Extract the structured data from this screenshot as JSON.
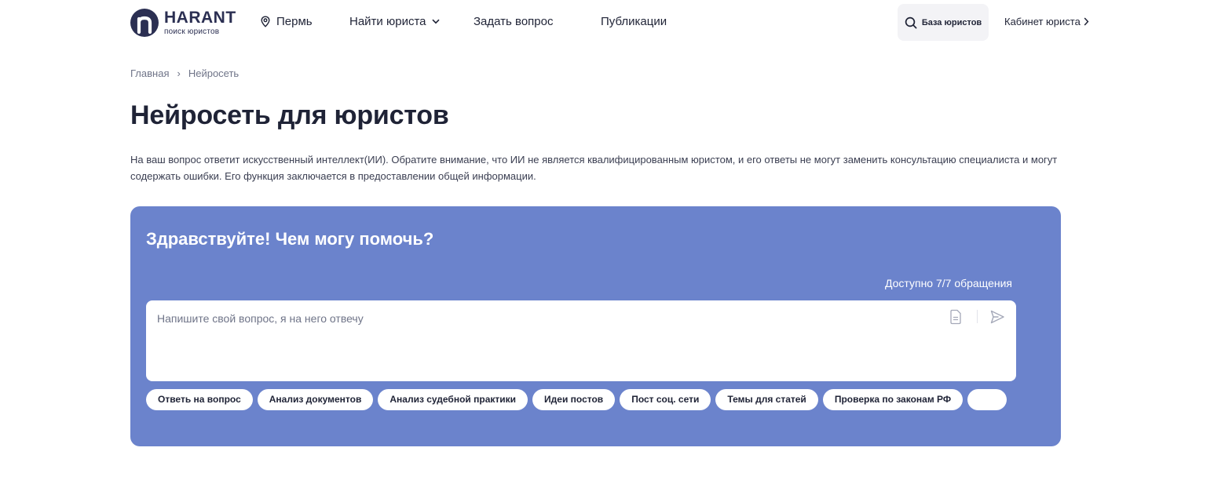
{
  "header": {
    "logo": {
      "name": "HARANT",
      "subtitle": "поиск юристов"
    },
    "city": "Пермь",
    "nav": {
      "find_lawyer": "Найти юриста",
      "ask_question": "Задать вопрос",
      "publications": "Публикации"
    },
    "base_button": "База юристов",
    "cabinet": "Кабинет юриста"
  },
  "breadcrumb": {
    "home": "Главная",
    "separator": "›",
    "current": "Нейросеть"
  },
  "page": {
    "title": "Нейросеть для юристов",
    "description": "На ваш вопрос ответит искусственный интеллект(ИИ). Обратите внимание, что ИИ не является квалифицированным юристом, и его ответы не могут заменить консультацию специалиста и могут содержать ошибки. Его функция заключается в предоставлении общей информации."
  },
  "chat": {
    "greeting": "Здравствуйте! Чем могу помочь?",
    "quota": "Доступно 7/7 обращения",
    "input_placeholder": "Напишите свой вопрос, я на него отвечу",
    "chips": [
      "Ответь на вопрос",
      "Анализ документов",
      "Анализ судебной практики",
      "Идеи постов",
      "Пост соц. сети",
      "Темы для статей",
      "Проверка по законам РФ",
      ""
    ]
  },
  "colors": {
    "brand_dark": "#2b2f52",
    "card_bg": "#6b83cc",
    "text_primary": "#1f2336",
    "text_muted": "#6f7488"
  },
  "icons": {
    "logo": "harant-logo-icon",
    "city": "location-pin-icon",
    "dropdown": "chevron-down-icon",
    "search": "search-icon",
    "cabinet": "chevron-right-icon",
    "attach": "document-icon",
    "send": "send-icon"
  }
}
